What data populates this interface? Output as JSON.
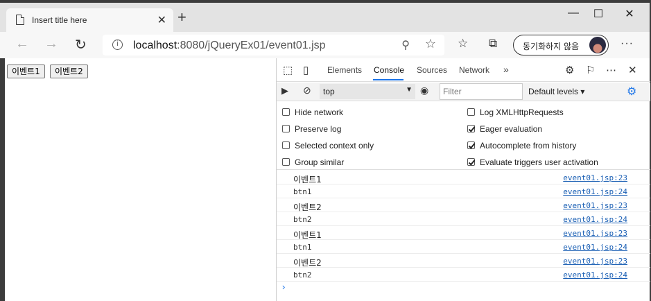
{
  "browser": {
    "tab_title": "Insert title here",
    "tab_close": "✕",
    "new_tab": "+",
    "window": {
      "minimize": "—",
      "maximize": "☐",
      "close": "✕"
    },
    "url_host": "localhost",
    "url_rest": ":8080/jQueryEx01/event01.jsp",
    "sync_label": "동기화하지 않음",
    "more": "···"
  },
  "page": {
    "buttons": [
      "이벤트1",
      "이벤트2"
    ]
  },
  "devtools": {
    "tabs": [
      "Elements",
      "Console",
      "Sources",
      "Network"
    ],
    "active_tab": "Console",
    "more_tabs": "»",
    "context": "top",
    "filter_placeholder": "Filter",
    "levels": "Default levels",
    "settings_left": [
      {
        "label": "Hide network",
        "checked": false
      },
      {
        "label": "Preserve log",
        "checked": false
      },
      {
        "label": "Selected context only",
        "checked": false
      },
      {
        "label": "Group similar",
        "checked": false
      }
    ],
    "settings_right": [
      {
        "label": "Log XMLHttpRequests",
        "checked": false
      },
      {
        "label": "Eager evaluation",
        "checked": true
      },
      {
        "label": "Autocomplete from history",
        "checked": true
      },
      {
        "label": "Evaluate triggers user activation",
        "checked": true
      }
    ],
    "log": [
      {
        "msg": "이벤트1",
        "src": "event01.jsp:23"
      },
      {
        "msg": "btn1",
        "src": "event01.jsp:24"
      },
      {
        "msg": "이벤트2",
        "src": "event01.jsp:23"
      },
      {
        "msg": "btn2",
        "src": "event01.jsp:24"
      },
      {
        "msg": "이벤트1",
        "src": "event01.jsp:23"
      },
      {
        "msg": "btn1",
        "src": "event01.jsp:24"
      },
      {
        "msg": "이벤트2",
        "src": "event01.jsp:23"
      },
      {
        "msg": "btn2",
        "src": "event01.jsp:24"
      }
    ],
    "prompt": "›"
  },
  "colors": {
    "accent": "#1a73e8",
    "link": "#1a5fb4"
  }
}
